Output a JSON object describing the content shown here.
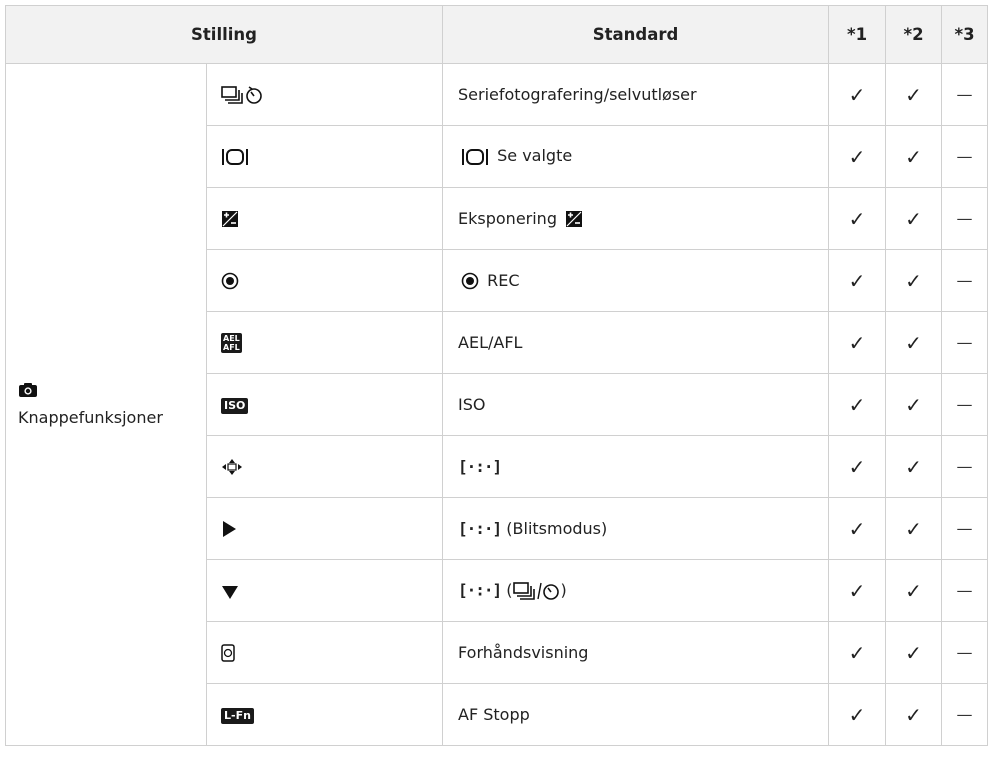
{
  "header": {
    "col_setting": "Stilling",
    "col_default": "Standard",
    "col_n1": "*1",
    "col_n2": "*2",
    "col_n3": "*3"
  },
  "group": {
    "icon": "camera-icon",
    "label": "Knappefunksjoner"
  },
  "rows": [
    {
      "icon": "drive-selftimer-icon",
      "default_text": "Seriefotografering/selvutløser",
      "c1": "✓",
      "c2": "✓",
      "c3": "—"
    },
    {
      "icon": "view-selected-icon",
      "default_text": "Se valgte",
      "c1": "✓",
      "c2": "✓",
      "c3": "—"
    },
    {
      "icon": "exposure-comp-icon",
      "default_text": "Eksponering",
      "c1": "✓",
      "c2": "✓",
      "c3": "—"
    },
    {
      "icon": "rec-icon",
      "default_text": "REC",
      "c1": "✓",
      "c2": "✓",
      "c3": "—"
    },
    {
      "icon": "ael-afl-icon",
      "badge_top": "AEL",
      "badge_bottom": "AFL",
      "default_text": "AEL/AFL",
      "c1": "✓",
      "c2": "✓",
      "c3": "—"
    },
    {
      "icon": "iso-icon",
      "badge": "ISO",
      "default_text": "ISO",
      "c1": "✓",
      "c2": "✓",
      "c3": "—"
    },
    {
      "icon": "arrow-pad-icon",
      "default_text": "[·:·]",
      "c1": "✓",
      "c2": "✓",
      "c3": "—"
    },
    {
      "icon": "right-arrow-icon",
      "default_text": "[·:·]",
      "default_suffix": "(Blitsmodus)",
      "c1": "✓",
      "c2": "✓",
      "c3": "—"
    },
    {
      "icon": "down-arrow-icon",
      "default_text": "[·:·]",
      "default_suffix_open": "(",
      "default_suffix_close": ")",
      "c1": "✓",
      "c2": "✓",
      "c3": "—"
    },
    {
      "icon": "preview-icon",
      "default_text": "Forhåndsvisning",
      "c1": "✓",
      "c2": "✓",
      "c3": "—"
    },
    {
      "icon": "lfn-icon",
      "badge": "L-Fn",
      "default_text": "AF Stopp",
      "c1": "✓",
      "c2": "✓",
      "c3": "—"
    }
  ]
}
